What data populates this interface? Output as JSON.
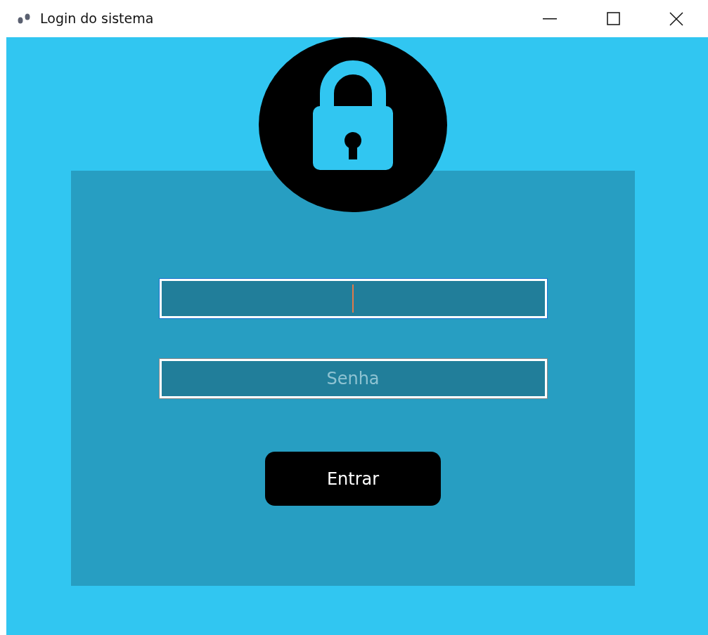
{
  "window": {
    "title": "Login do sistema"
  },
  "fields": [
    {
      "focused": true
    },
    {
      "focused": false,
      "placeholder": "Senha"
    }
  ],
  "button": {
    "label": "Entrar"
  }
}
